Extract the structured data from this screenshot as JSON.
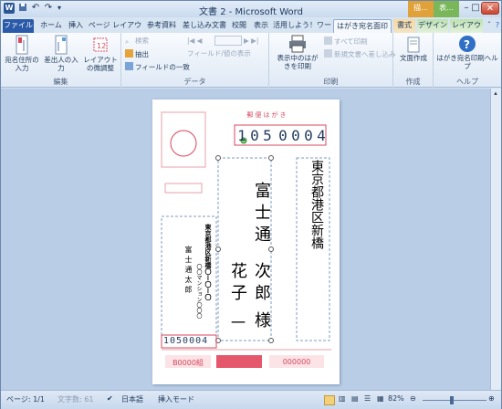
{
  "window": {
    "title": "文書 2 - Microsoft Word",
    "ctx_tab_a": "描...",
    "ctx_tab_b": "表...",
    "min": "–",
    "max": "□",
    "close": "✕"
  },
  "tabs": [
    {
      "label": "ファイル",
      "type": "file"
    },
    {
      "label": "ホーム"
    },
    {
      "label": "挿入"
    },
    {
      "label": "ページ レイアウト"
    },
    {
      "label": "参考資料"
    },
    {
      "label": "差し込み文書"
    },
    {
      "label": "校閲"
    },
    {
      "label": "表示"
    },
    {
      "label": "活用しよう！ワー"
    },
    {
      "label": "はがき宛名面印刷",
      "active": true
    },
    {
      "label": "書式",
      "ctx": "a"
    },
    {
      "label": "デザイン",
      "ctx": "b"
    },
    {
      "label": "レイアウト",
      "ctx": "b"
    }
  ],
  "ribbon": {
    "edit": {
      "label": "編集",
      "btn1": "宛名住所の入力",
      "btn2": "差出人の入力",
      "btn3": "レイアウトの微調整"
    },
    "data": {
      "label": "データ",
      "search": "検索",
      "extract": "抽出",
      "fields": "フィールドの一致",
      "nav_field": "フィールド/値の表示"
    },
    "print": {
      "label": "印刷",
      "btn": "表示中のはがきを印刷",
      "all": "すべて印刷",
      "merge": "新規文書へ差し込み"
    },
    "create": {
      "label": "作成",
      "btn": "文面作成"
    },
    "help": {
      "label": "ヘルプ",
      "btn": "はがき宛名印刷ヘルプ"
    }
  },
  "card": {
    "header": "郵便はがき",
    "postal": [
      "1",
      "0",
      "5",
      "0",
      "0",
      "0",
      "4"
    ],
    "recipient_address": "東京都港区新橋",
    "recipient_name_a": "富士通",
    "recipient_name_b": "次郎",
    "recipient_name_c": "花子",
    "honorific": "様",
    "honorific_line": "一",
    "sender_address": "東京都港区新橋〇ー〇ー〇",
    "sender_bldg": "〇〇マンション〇〇〇",
    "sender_name": "富士通太郎",
    "sender_postal": "1050004",
    "lottery_a": "B0000組",
    "lottery_b": "000000"
  },
  "status": {
    "page": "ページ: 1/1",
    "words": "文字数: 61",
    "lang": "日本語",
    "mode": "挿入モード",
    "zoom": "82%"
  }
}
